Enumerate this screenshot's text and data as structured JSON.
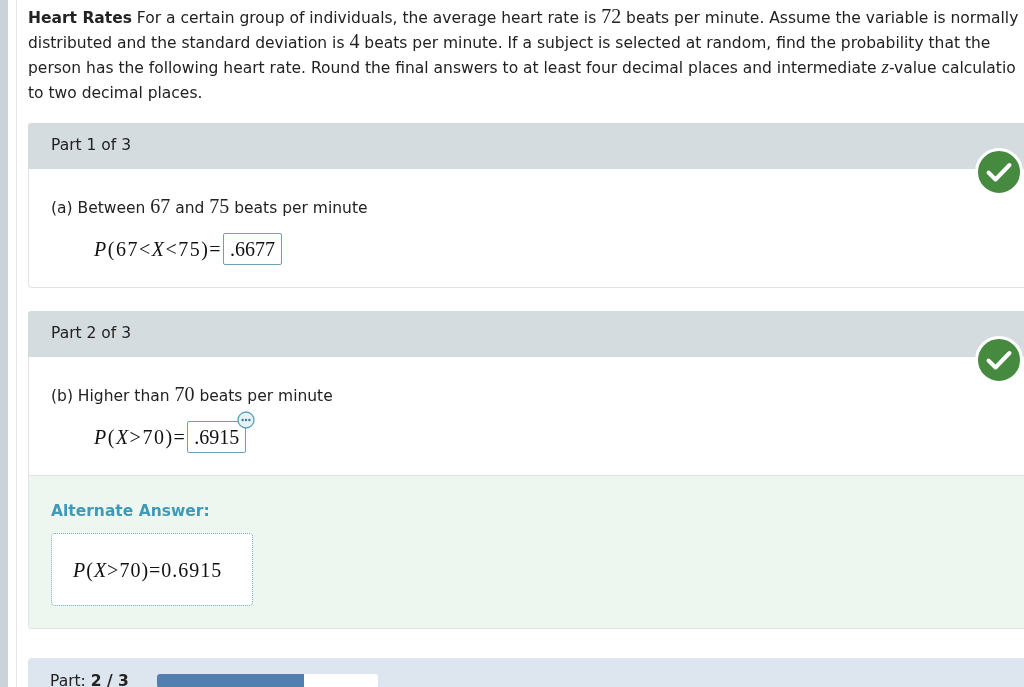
{
  "problem": {
    "title": "Heart Rates",
    "runs": [
      {
        "kind": "text",
        "text": " For a certain group of individuals, the average heart rate is "
      },
      {
        "kind": "math",
        "text": "72"
      },
      {
        "kind": "text",
        "text": " beats per minute. Assume the variable is normally distributed and the standard deviation is "
      },
      {
        "kind": "math",
        "text": "4"
      },
      {
        "kind": "text",
        "text": " beats per minute. If a subject is selected at random, find the probability that the person has the following heart rate. Round the final answers to at least four decimal places and intermediate "
      },
      {
        "kind": "math_italic",
        "text": "z"
      },
      {
        "kind": "text",
        "text": "-value calculatio to two decimal places."
      }
    ]
  },
  "parts": [
    {
      "header": "Part 1 of 3",
      "correct": true,
      "question": [
        {
          "kind": "text",
          "text": "(a) Between "
        },
        {
          "kind": "math",
          "text": "67"
        },
        {
          "kind": "text",
          "text": " and "
        },
        {
          "kind": "math",
          "text": "75"
        },
        {
          "kind": "text",
          "text": " beats per minute"
        }
      ],
      "equation": "*P*(67<*X*<75)=",
      "answer": ".6677",
      "menu": false
    },
    {
      "header": "Part 2 of 3",
      "correct": true,
      "question": [
        {
          "kind": "text",
          "text": "(b) Higher than "
        },
        {
          "kind": "math",
          "text": "70"
        },
        {
          "kind": "text",
          "text": " beats per minute"
        }
      ],
      "equation": "*P*(*X*>70)=",
      "answer": ".6915",
      "menu": true,
      "alternate_answer": {
        "label": "Alternate Answer:",
        "equation": "*P*(*X*>70)=0.6915"
      }
    }
  ],
  "progress": {
    "label": "Part: **2 / 3**",
    "level": 0.6667
  }
}
